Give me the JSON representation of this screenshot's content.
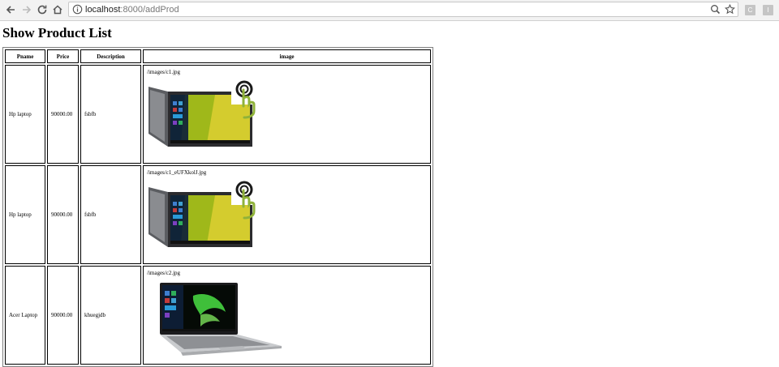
{
  "browser": {
    "url_host": "localhost",
    "url_path": ":8000/addProd",
    "extensions": [
      "C",
      "I"
    ]
  },
  "page": {
    "title": "Show Product List"
  },
  "table": {
    "headers": {
      "pname": "Pname",
      "price": "Price",
      "description": "Description",
      "image": "image"
    },
    "rows": [
      {
        "pname": "Hp laptop",
        "price": "90000.00",
        "description": "fsbfb",
        "image_path": "/images/c1.jpg"
      },
      {
        "pname": "Hp laptop",
        "price": "90000.00",
        "description": "fsbfb",
        "image_path": "/images/c1_eUFXkolJ.jpg"
      },
      {
        "pname": "Acer Laptop",
        "price": "90000.00",
        "description": "khuegjdb",
        "image_path": "/images/c2.jpg"
      }
    ]
  },
  "colors": {
    "screen_green": "#9fb81a",
    "screen_yellow": "#d4cc2e",
    "laptop_gray": "#6c6e72",
    "acer_green": "#3fbf3a"
  }
}
